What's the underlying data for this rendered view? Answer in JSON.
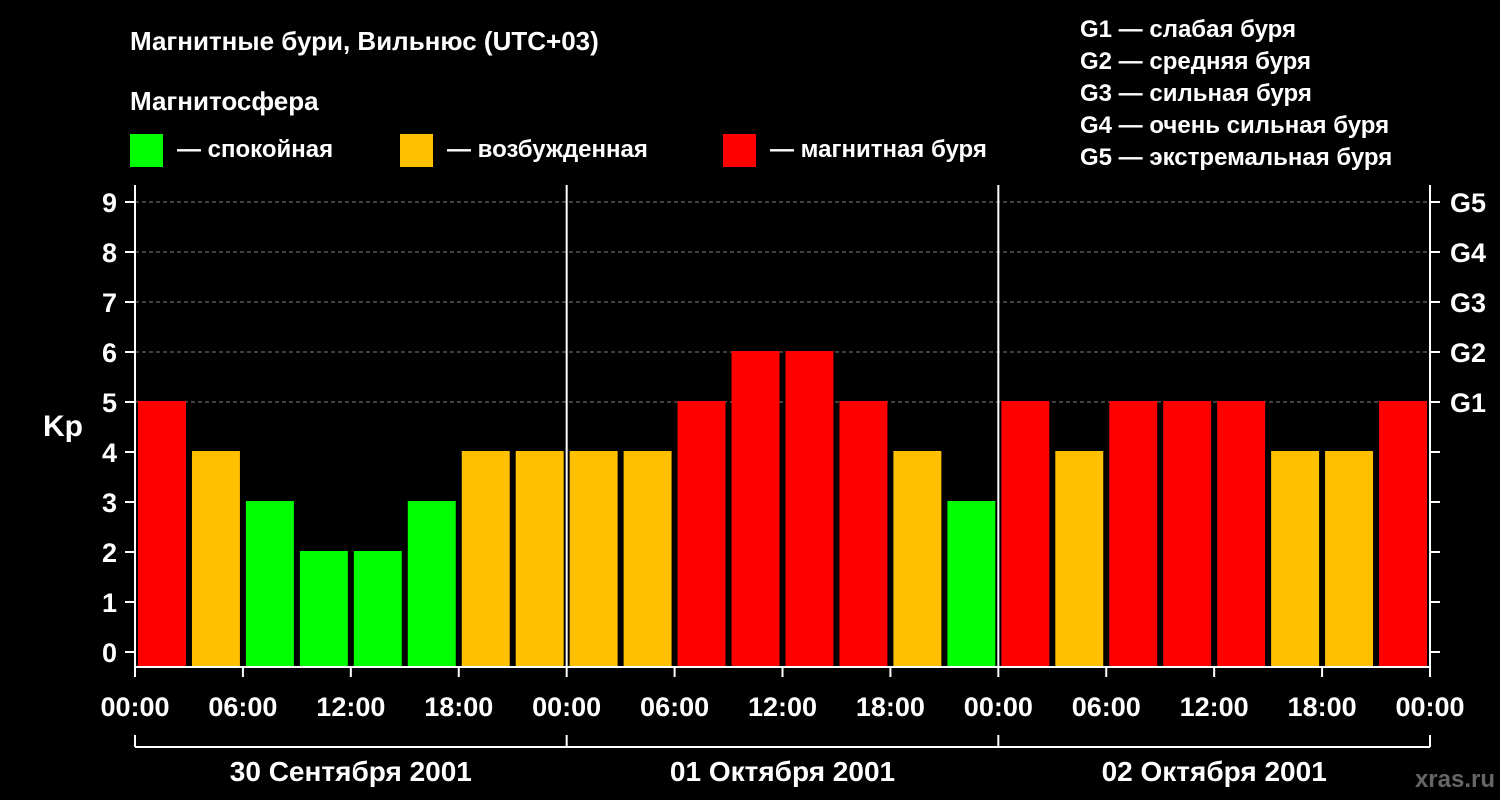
{
  "chart_data": {
    "type": "bar",
    "title": "Магнитные бури, Вильнюс (UTC+03)",
    "subtitle": "Магнитосфера",
    "ylabel": "Kp",
    "ylim": [
      0,
      9
    ],
    "y_ticks": [
      "0",
      "1",
      "2",
      "3",
      "4",
      "5",
      "6",
      "7",
      "8",
      "9"
    ],
    "right_ticks": [
      {
        "value": 5,
        "label": "G1"
      },
      {
        "value": 6,
        "label": "G2"
      },
      {
        "value": 7,
        "label": "G3"
      },
      {
        "value": 8,
        "label": "G4"
      },
      {
        "value": 9,
        "label": "G5"
      }
    ],
    "x_ticks": [
      "00:00",
      "06:00",
      "12:00",
      "18:00",
      "00:00",
      "06:00",
      "12:00",
      "18:00",
      "00:00",
      "06:00",
      "12:00",
      "18:00",
      "00:00"
    ],
    "days": [
      "30 Сентября 2001",
      "01 Октября 2001",
      "02 Октября 2001"
    ],
    "values": [
      5,
      4,
      3,
      2,
      2,
      3,
      4,
      4,
      4,
      4,
      5,
      6,
      6,
      5,
      4,
      3,
      5,
      4,
      5,
      5,
      5,
      4,
      4,
      5
    ],
    "grid": true,
    "legend": {
      "position": "top",
      "items": [
        {
          "label": "— спокойная",
          "color": "#00ff00",
          "max": 3
        },
        {
          "label": "— возбужденная",
          "color": "#ffc000",
          "max": 4
        },
        {
          "label": "— магнитная буря",
          "color": "#ff0000",
          "max": 9
        }
      ]
    },
    "storm_scale": [
      "G1 — слабая буря",
      "G2 — средняя буря",
      "G3 — сильная буря",
      "G4 — очень сильная буря",
      "G5 — экстремальная буря"
    ],
    "watermark": "xras.ru",
    "colors": {
      "background": "#000000",
      "axis": "#ffffff",
      "grid": "#808080"
    }
  }
}
